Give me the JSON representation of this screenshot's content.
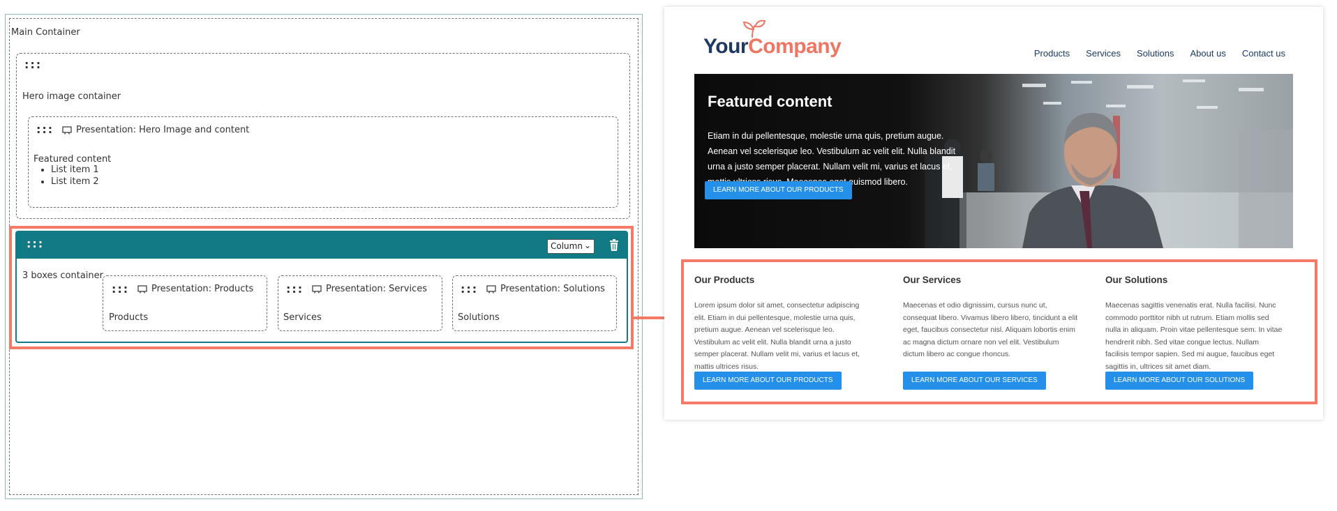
{
  "editor": {
    "main_label": "Main Container",
    "hero_label": "Hero image container",
    "hero_presentation": "Presentation: Hero Image and content",
    "featured_label": "Featured content",
    "list_items": [
      "List item 1",
      "List item 2"
    ],
    "boxes_label": "3 boxes container",
    "column_select": "Column",
    "presentations": [
      {
        "title": "Presentation: Products",
        "content": "Products"
      },
      {
        "title": "Presentation: Services",
        "content": "Services"
      },
      {
        "title": "Presentation: Solutions",
        "content": "Solutions"
      }
    ]
  },
  "site": {
    "logo_your": "Your",
    "logo_company": "Company",
    "nav": [
      "Products",
      "Services",
      "Solutions",
      "About us",
      "Contact us"
    ],
    "hero_title": "Featured content",
    "hero_text": "Etiam in dui pellentesque, molestie urna quis, pretium augue. Aenean vel scelerisque leo. Vestibulum ac velit elit. Nulla blandit urna a justo semper placerat. Nullam velit mi, varius et lacus et, mattis ultrices risus. Maecenas eget euismod libero.",
    "hero_button": "LEARN MORE ABOUT OUR PRODUCTS",
    "boxes": [
      {
        "title": "Our Products",
        "text": "Lorem ipsum dolor sit amet, consectetur adipiscing elit. Etiam in dui pellentesque, molestie urna quis, pretium augue. Aenean vel scelerisque leo. Vestibulum ac velit elit. Nulla blandit urna a justo semper placerat. Nullam velit mi, varius et lacus et, mattis ultrices risus.",
        "button": "LEARN MORE ABOUT OUR PRODUCTS"
      },
      {
        "title": "Our Services",
        "text": "Maecenas et odio dignissim, cursus nunc ut, consequat libero. Vivamus libero libero, tincidunt a elit eget, faucibus consectetur nisl. Aliquam lobortis enim ac magna dictum ornare non vel elit. Vestibulum dictum libero ac congue rhoncus.",
        "button": "LEARN MORE ABOUT OUR SERVICES"
      },
      {
        "title": "Our Solutions",
        "text": "Maecenas sagittis venenatis erat. Nulla facilisi. Nunc commodo porttitor nibh ut rutrum. Etiam mollis sed nulla in aliquam. Proin vitae pellentesque sem. In vitae hendrerit nibh. Sed vitae congue lectus. Nullam facilisis tempor sapien. Sed mi augue, faucibus eget sagittis in, ultrices sit amet diam.",
        "button": "LEARN MORE ABOUT OUR SOLUTIONS"
      }
    ]
  },
  "colors": {
    "accent_teal": "#117a85",
    "highlight_coral": "#f37a66",
    "button_blue": "#2490e9",
    "logo_navy": "#1c3a63"
  }
}
